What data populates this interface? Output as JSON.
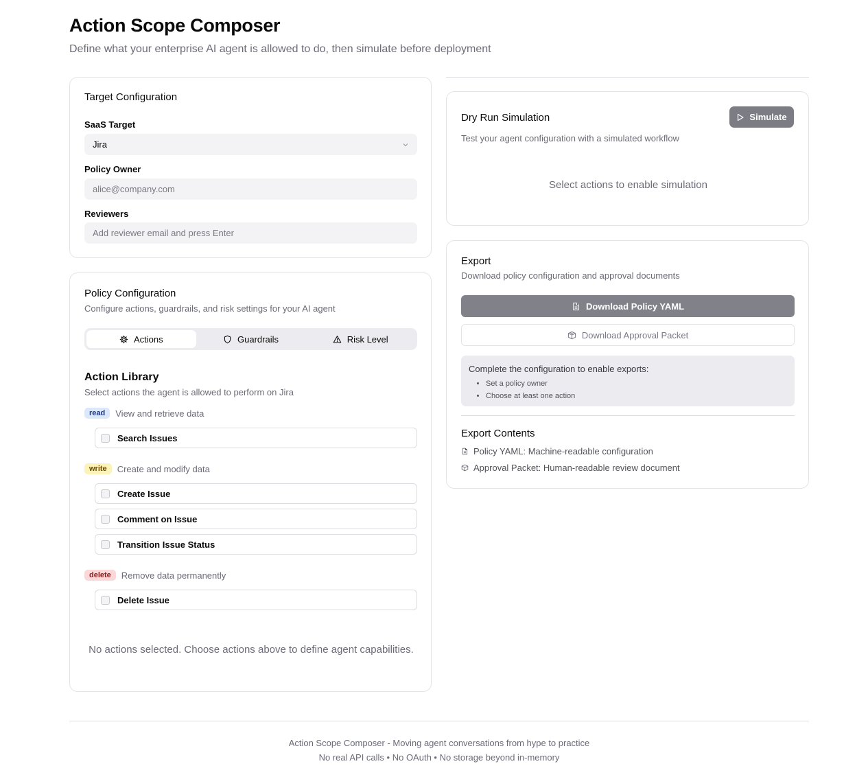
{
  "header": {
    "title": "Action Scope Composer",
    "subtitle": "Define what your enterprise AI agent is allowed to do, then simulate before deployment"
  },
  "target": {
    "title": "Target Configuration",
    "saas_label": "SaaS Target",
    "saas_value": "Jira",
    "owner_label": "Policy Owner",
    "owner_placeholder": "alice@company.com",
    "reviewers_label": "Reviewers",
    "reviewers_placeholder": "Add reviewer email and press Enter"
  },
  "policy": {
    "title": "Policy Configuration",
    "description": "Configure actions, guardrails, and risk settings for your AI agent",
    "tabs": [
      {
        "label": "Actions",
        "icon": "gear-icon",
        "active": true
      },
      {
        "label": "Guardrails",
        "icon": "shield-icon",
        "active": false
      },
      {
        "label": "Risk Level",
        "icon": "warning-icon",
        "active": false
      }
    ],
    "library_title": "Action Library",
    "library_desc": "Select actions the agent is allowed to perform on Jira",
    "groups": [
      {
        "badge": "read",
        "desc": "View and retrieve data",
        "actions": [
          "Search Issues"
        ]
      },
      {
        "badge": "write",
        "desc": "Create and modify data",
        "actions": [
          "Create Issue",
          "Comment on Issue",
          "Transition Issue Status"
        ]
      },
      {
        "badge": "delete",
        "desc": "Remove data permanently",
        "actions": [
          "Delete Issue"
        ]
      }
    ],
    "empty_message": "No actions selected. Choose actions above to define agent capabilities."
  },
  "simulation": {
    "title": "Dry Run Simulation",
    "description": "Test your agent configuration with a simulated workflow",
    "button": "Simulate",
    "empty_message": "Select actions to enable simulation"
  },
  "export": {
    "title": "Export",
    "description": "Download policy configuration and approval documents",
    "yaml_button": "Download Policy YAML",
    "packet_button": "Download Approval Packet",
    "notice_title": "Complete the configuration to enable exports:",
    "notice_items": [
      "Set a policy owner",
      "Choose at least one action"
    ],
    "contents_title": "Export Contents",
    "contents_items": [
      "Policy YAML: Machine-readable configuration",
      "Approval Packet: Human-readable review document"
    ]
  },
  "footer": {
    "line1": "Action Scope Composer - Moving agent conversations from hype to practice",
    "line2": "No real API calls • No OAuth • No storage beyond in-memory"
  },
  "colors": {
    "read_badge": "#dbe7fb",
    "write_badge": "#fbf3b8",
    "delete_badge": "#fbd7d7",
    "disabled_button": "#81818a"
  }
}
